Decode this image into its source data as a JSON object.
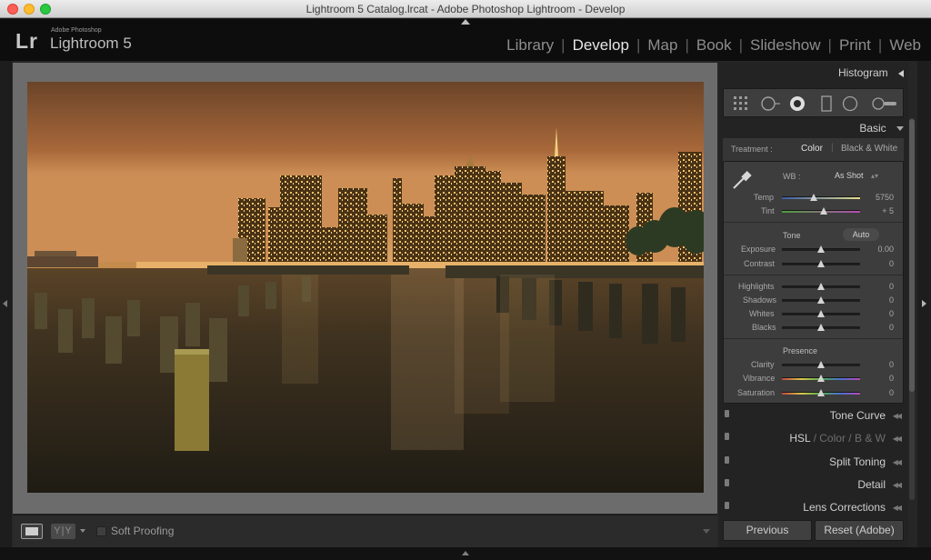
{
  "window": {
    "title": "Lightroom 5 Catalog.lrcat - Adobe Photoshop Lightroom - Develop"
  },
  "identity": {
    "logo": "Lr",
    "company": "Adobe Photoshop",
    "product": "Lightroom 5"
  },
  "modules": [
    {
      "label": "Library",
      "active": false
    },
    {
      "label": "Develop",
      "active": true
    },
    {
      "label": "Map",
      "active": false
    },
    {
      "label": "Book",
      "active": false
    },
    {
      "label": "Slideshow",
      "active": false
    },
    {
      "label": "Print",
      "active": false
    },
    {
      "label": "Web",
      "active": false
    }
  ],
  "toolbar": {
    "compare_label": "Y|Y",
    "soft_proofing_label": "Soft Proofing",
    "soft_proofing_checked": false
  },
  "panels": {
    "histogram": {
      "title": "Histogram"
    },
    "basic": {
      "title": "Basic",
      "treatment_label": "Treatment :",
      "treatment_color": "Color",
      "treatment_bw": "Black & White",
      "treatment_separator": "|",
      "wb_label": "WB :",
      "wb_value": "As Shot",
      "wb_caret": "▴▾",
      "temp": {
        "label": "Temp",
        "value": "5750",
        "position": 0.41
      },
      "tint": {
        "label": "Tint",
        "value": "+ 5",
        "position": 0.53
      },
      "tone_label": "Tone",
      "auto_label": "Auto",
      "exposure": {
        "label": "Exposure",
        "value": "0.00",
        "position": 0.5
      },
      "contrast": {
        "label": "Contrast",
        "value": "0",
        "position": 0.5
      },
      "highlights": {
        "label": "Highlights",
        "value": "0",
        "position": 0.5
      },
      "shadows": {
        "label": "Shadows",
        "value": "0",
        "position": 0.5
      },
      "whites": {
        "label": "Whites",
        "value": "0",
        "position": 0.5
      },
      "blacks": {
        "label": "Blacks",
        "value": "0",
        "position": 0.5
      },
      "presence_label": "Presence",
      "clarity": {
        "label": "Clarity",
        "value": "0",
        "position": 0.5
      },
      "vibrance": {
        "label": "Vibrance",
        "value": "0",
        "position": 0.5
      },
      "saturation": {
        "label": "Saturation",
        "value": "0",
        "position": 0.5
      }
    },
    "tone_curve": {
      "title": "Tone Curve"
    },
    "hsl": {
      "hsl": "HSL",
      "sep1": "/",
      "color": "Color",
      "sep2": "/",
      "bw": "B & W"
    },
    "split_toning": {
      "title": "Split Toning"
    },
    "detail": {
      "title": "Detail"
    },
    "lens_corrections": {
      "title": "Lens Corrections"
    }
  },
  "buttons": {
    "previous": "Previous",
    "reset": "Reset (Adobe)"
  },
  "colors": {
    "accent_text": "#e6e6e6",
    "panel_bg": "#3d3d3d",
    "sky": "#c9864f"
  }
}
